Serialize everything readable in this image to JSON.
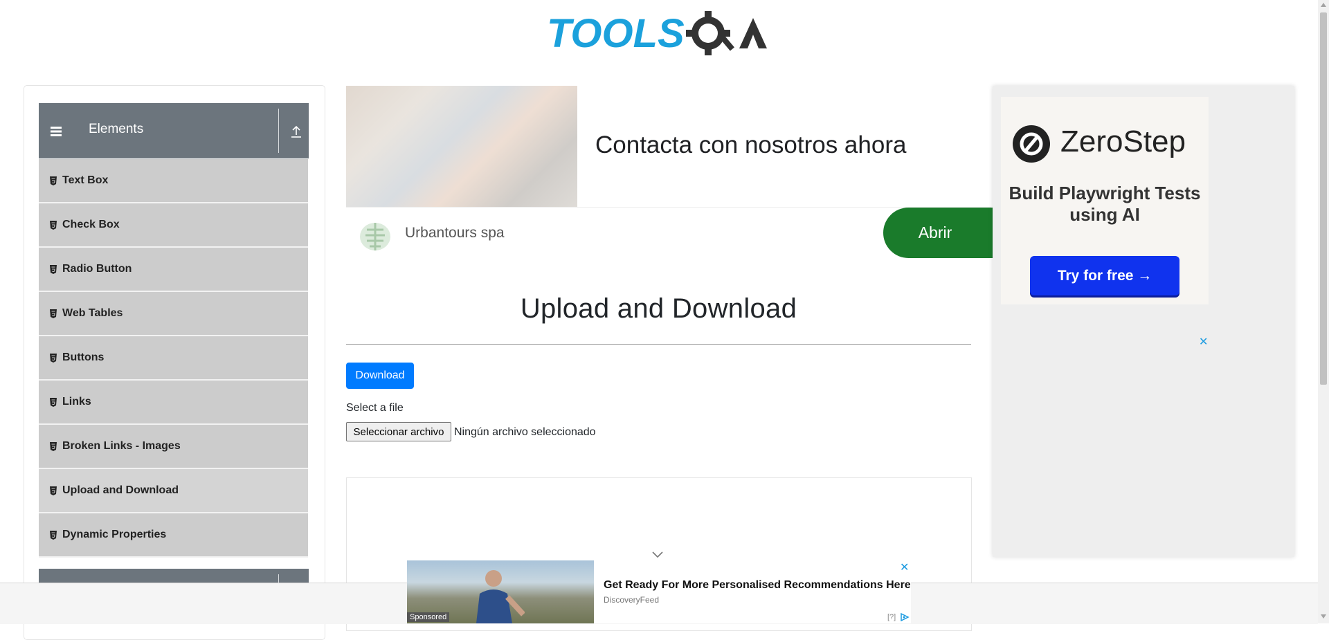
{
  "header": {
    "logo_text_tools": "TOOLS",
    "logo_text_qa": "QA"
  },
  "sidebar": {
    "group_title": "Elements",
    "items": [
      {
        "label": "Text Box"
      },
      {
        "label": "Check Box"
      },
      {
        "label": "Radio Button"
      },
      {
        "label": "Web Tables"
      },
      {
        "label": "Buttons"
      },
      {
        "label": "Links"
      },
      {
        "label": "Broken Links - Images"
      },
      {
        "label": "Upload and Download"
      },
      {
        "label": "Dynamic Properties"
      }
    ],
    "active_item": "Upload and Download"
  },
  "top_ad": {
    "headline": "Contacta con nosotros ahora",
    "advertiser": "Urbantours spa",
    "button_label": "Abrir",
    "button_color": "#1a7b2b"
  },
  "main": {
    "title": "Upload and Download",
    "download_button": "Download",
    "select_label": "Select a file",
    "file_button": "Seleccionar archivo",
    "file_status": "Ningún archivo seleccionado"
  },
  "right_ad": {
    "brand": "ZeroStep",
    "tagline": "Build Playwright Tests using AI",
    "cta": "Try for free →",
    "cta_color": "#1033ee",
    "close": "✕"
  },
  "bottom_ad": {
    "headline": "Get Ready For More Personalised Recommendations Here",
    "source": "DiscoveryFeed",
    "sponsored": "Sponsored",
    "help": "[?]",
    "close": "✕"
  },
  "colors": {
    "primary_button": "#007bff",
    "sidebar_header": "#6c757d",
    "sidebar_item": "#cccccc",
    "logo_blue": "#1ba1dc",
    "logo_dark": "#333333"
  }
}
